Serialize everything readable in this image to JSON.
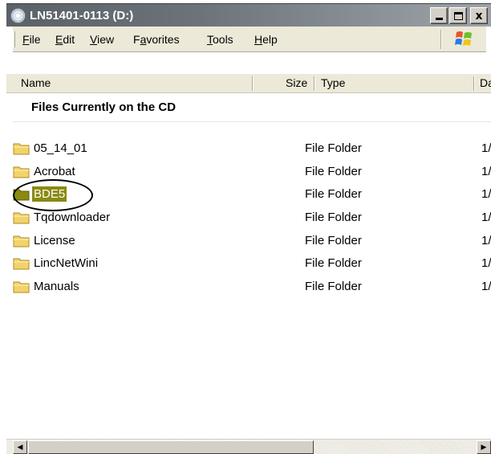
{
  "window": {
    "title": "LN51401-0113 (D:)",
    "title_icon": "cd-drive-icon",
    "controls": {
      "minimize": "minimize",
      "maximize": "maximize",
      "close": "x"
    }
  },
  "menubar": {
    "items": [
      {
        "label_accel": "F",
        "label_rest": "ile"
      },
      {
        "label_accel": "E",
        "label_rest": "dit"
      },
      {
        "label_accel": "V",
        "label_rest": "iew"
      },
      {
        "label_pre": "F",
        "label_accel": "a",
        "label_rest": "vorites"
      },
      {
        "label_accel": "T",
        "label_rest": "ools"
      },
      {
        "label_accel": "H",
        "label_rest": "elp"
      }
    ],
    "logo": "windows-flag-icon"
  },
  "columns": {
    "name": "Name",
    "size": "Size",
    "type": "Type",
    "date": "Da"
  },
  "group": {
    "heading": "Files Currently on the CD"
  },
  "rows": [
    {
      "name": "05_14_01",
      "type": "File Folder",
      "date": "1/"
    },
    {
      "name": "Acrobat",
      "type": "File Folder",
      "date": "1/"
    },
    {
      "name": "BDE5",
      "type": "File Folder",
      "date": "1/",
      "selected": true
    },
    {
      "name": "Tqdownloader",
      "type": "File Folder",
      "date": "1/"
    },
    {
      "name": "License",
      "type": "File Folder",
      "date": "1/"
    },
    {
      "name": "LincNetWini",
      "type": "File Folder",
      "date": "1/"
    },
    {
      "name": "Manuals",
      "type": "File Folder",
      "date": "1/"
    }
  ],
  "colors": {
    "selection": "#8a8a12",
    "folder": "#f2d36b"
  },
  "scrollbar": {
    "left_arrow": "◀",
    "right_arrow": "▶"
  }
}
